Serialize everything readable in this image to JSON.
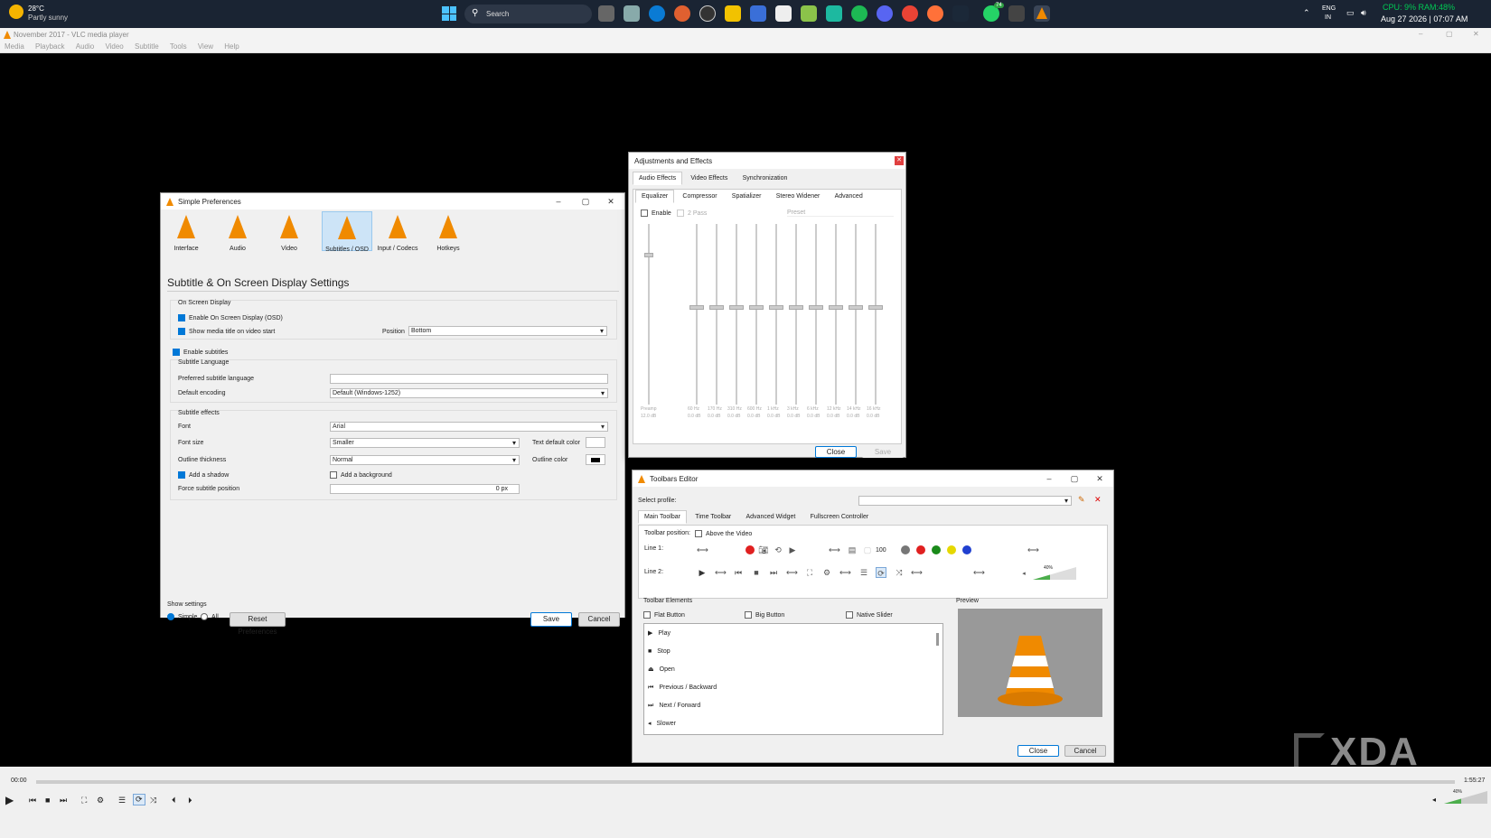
{
  "weather": {
    "temp": "28°C",
    "desc": "Partly sunny"
  },
  "taskbar": {
    "search_placeholder": "Search",
    "lang_line1": "ENG",
    "lang_line2": "IN",
    "datetime": "Aug 27 2026 | 07:07 AM",
    "perf": "CPU: 9% RAM:48%",
    "badge": "74"
  },
  "vlc_window": {
    "title": "November 2017 - VLC media player",
    "menu": [
      "Media",
      "Playback",
      "Audio",
      "Video",
      "Subtitle",
      "Tools",
      "View",
      "Help"
    ],
    "time_elapsed": "00:00",
    "time_total": "1:55:27",
    "volume": "40%"
  },
  "prefs": {
    "title": "Simple Preferences",
    "categories": [
      "Interface",
      "Audio",
      "Video",
      "Subtitles / OSD",
      "Input / Codecs",
      "Hotkeys"
    ],
    "heading": "Subtitle & On Screen Display Settings",
    "osd_group": "On Screen Display",
    "enable_osd": "Enable On Screen Display (OSD)",
    "show_title": "Show media title on video start",
    "position_label": "Position",
    "position_value": "Bottom",
    "enable_subs": "Enable subtitles",
    "lang_group": "Subtitle Language",
    "pref_lang_label": "Preferred subtitle language",
    "encoding_label": "Default encoding",
    "encoding_value": "Default (Windows-1252)",
    "effects_group": "Subtitle effects",
    "font_label": "Font",
    "font_value": "Arial",
    "fontsize_label": "Font size",
    "fontsize_value": "Smaller",
    "text_color_label": "Text default color",
    "outline_label": "Outline thickness",
    "outline_value": "Normal",
    "outline_color_label": "Outline color",
    "shadow": "Add a shadow",
    "background": "Add a background",
    "force_pos_label": "Force subtitle position",
    "force_pos_value": "0 px",
    "show_settings": "Show settings",
    "simple": "Simple",
    "all": "All",
    "reset": "Reset Preferences",
    "save": "Save",
    "cancel": "Cancel"
  },
  "adjust": {
    "title": "Adjustments and Effects",
    "tabs": [
      "Audio Effects",
      "Video Effects",
      "Synchronization"
    ],
    "subtabs": [
      "Equalizer",
      "Compressor",
      "Spatializer",
      "Stereo Widener",
      "Advanced"
    ],
    "enable": "Enable",
    "two_pass": "2 Pass",
    "preset": "Preset",
    "preamp": "Preamp",
    "preamp_val": "12.0 dB",
    "bands": [
      "60 Hz",
      "170 Hz",
      "310 Hz",
      "600 Hz",
      "1 kHz",
      "3 kHz",
      "6 kHz",
      "12 kHz",
      "14 kHz",
      "16 kHz"
    ],
    "band_val": "0.0 dB",
    "close": "Close",
    "save": "Save"
  },
  "toolbars": {
    "title": "Toolbars Editor",
    "select_profile": "Select profile:",
    "tabs": [
      "Main Toolbar",
      "Time Toolbar",
      "Advanced Widget",
      "Fullscreen Controller"
    ],
    "toolbar_position": "Toolbar position:",
    "above_video": "Above the Video",
    "line1": "Line 1:",
    "line2": "Line 2:",
    "zoom_val": "100",
    "volume_val": "40%",
    "elements_group": "Toolbar Elements",
    "flat_button": "Flat Button",
    "big_button": "Big Button",
    "native_slider": "Native Slider",
    "elements": [
      "Play",
      "Stop",
      "Open",
      "Previous / Backward",
      "Next / Forward",
      "Slower"
    ],
    "preview": "Preview",
    "close": "Close",
    "cancel": "Cancel"
  },
  "watermark": "XDA"
}
